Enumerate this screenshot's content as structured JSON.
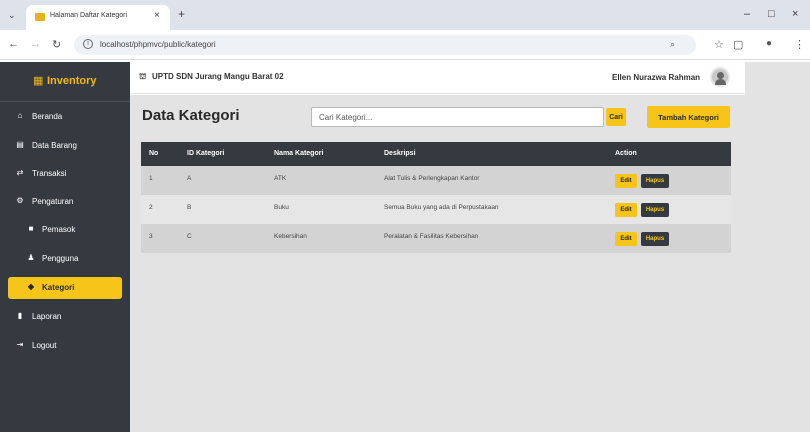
{
  "browser": {
    "tab_title": "Halaman Daftar Kategori",
    "url": "localhost/phpmvc/public/kategori"
  },
  "sidebar": {
    "brand": "Inventory",
    "items": [
      {
        "label": "Beranda",
        "icon": "home-icon",
        "glyph": "⌂"
      },
      {
        "label": "Data Barang",
        "icon": "table-icon",
        "glyph": "▤"
      },
      {
        "label": "Transaksi",
        "icon": "exchange-icon",
        "glyph": "⇄"
      },
      {
        "label": "Pengaturan",
        "icon": "cogs-icon",
        "glyph": "⚙"
      },
      {
        "label": "Pemasok",
        "icon": "truck-icon",
        "glyph": "■"
      },
      {
        "label": "Pengguna",
        "icon": "users-icon",
        "glyph": "♟"
      },
      {
        "label": "Kategori",
        "icon": "tags-icon",
        "glyph": "◆"
      },
      {
        "label": "Laporan",
        "icon": "file-icon",
        "glyph": "▮"
      },
      {
        "label": "Logout",
        "icon": "sign-out-icon",
        "glyph": "⇥"
      }
    ]
  },
  "header": {
    "school_name": "UPTD SDN Jurang Mangu Barat 02",
    "user_name": "Ellen Nurazwa Rahman"
  },
  "main": {
    "title": "Data Kategori",
    "search_placeholder": "Cari Kategori...",
    "search_button": "Cari",
    "add_button": "Tambah Kategori",
    "table": {
      "headers": [
        "No",
        "ID Kategori",
        "Nama Kategori",
        "Deskripsi",
        "Action"
      ],
      "rows": [
        {
          "no": "1",
          "id": "A",
          "nama": "ATK",
          "deskripsi": "Alat Tulis & Perlengkapan Kantor"
        },
        {
          "no": "2",
          "id": "B",
          "nama": "Buku",
          "deskripsi": "Semua Buku yang ada di Perpustakaan"
        },
        {
          "no": "3",
          "id": "C",
          "nama": "Kebersihan",
          "deskripsi": "Peralatan & Fasilitas Kebersihan"
        }
      ],
      "edit_label": "Edit",
      "hapus_label": "Hapus"
    }
  },
  "colors": {
    "accent": "#f7c41a",
    "sidebar_bg": "#343a40",
    "content_bg": "#e3e3e3"
  }
}
